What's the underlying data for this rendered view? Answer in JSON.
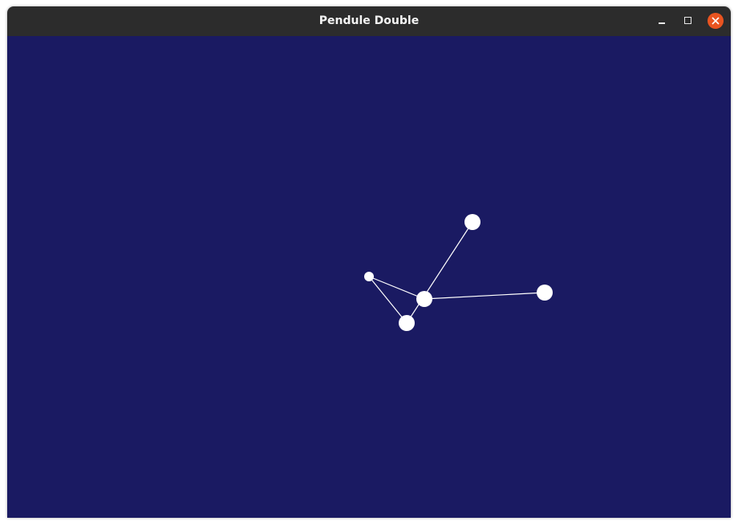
{
  "window": {
    "title": "Pendule Double",
    "icons": {
      "minimize": "minimize-icon",
      "maximize": "maximize-icon",
      "close": "close-icon"
    }
  },
  "colors": {
    "titlebar": "#2c2c2c",
    "canvas_background": "#1a1a62",
    "pendulum": "#ffffff",
    "close_button": "#e95420"
  }
}
